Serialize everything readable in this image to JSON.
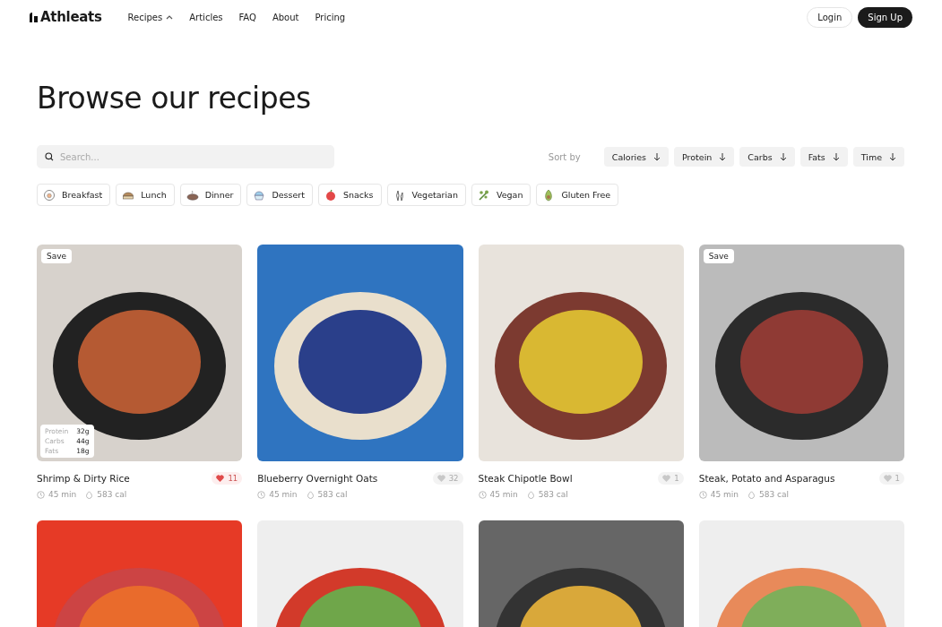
{
  "brand": "Athleats",
  "nav": [
    {
      "label": "Recipes",
      "dropdown": true
    },
    {
      "label": "Articles",
      "dropdown": false
    },
    {
      "label": "FAQ",
      "dropdown": false
    },
    {
      "label": "About",
      "dropdown": false
    },
    {
      "label": "Pricing",
      "dropdown": false
    }
  ],
  "auth": {
    "login": "Login",
    "signup": "Sign Up"
  },
  "heading": "Browse our recipes",
  "search": {
    "placeholder": "Search..."
  },
  "sort": {
    "label": "Sort by",
    "options": [
      "Calories",
      "Protein",
      "Carbs",
      "Fats",
      "Time"
    ]
  },
  "categories": [
    "Breakfast",
    "Lunch",
    "Dinner",
    "Dessert",
    "Snacks",
    "Vegetarian",
    "Vegan",
    "Gluten Free"
  ],
  "cards": [
    {
      "kind": "recipe",
      "title": "Shrimp & Dirty Rice",
      "time": "45 min",
      "calories": "583 cal",
      "likes": "11",
      "liked": true,
      "save_label": "Save",
      "macros": [
        {
          "label": "Protein",
          "value": "32g"
        },
        {
          "label": "Carbs",
          "value": "44g"
        },
        {
          "label": "Fats",
          "value": "18g"
        }
      ]
    },
    {
      "kind": "recipe",
      "title": "Blueberry Overnight Oats",
      "time": "45 min",
      "calories": "583 cal",
      "likes": "32",
      "liked": false
    },
    {
      "kind": "recipe",
      "title": "Steak Chipotle Bowl",
      "time": "45 min",
      "calories": "583 cal",
      "likes": "1",
      "liked": false
    },
    {
      "kind": "recipe",
      "title": "Steak, Potato and Asparagus",
      "time": "45 min",
      "calories": "583 cal",
      "likes": "1",
      "liked": false,
      "save_label": "Save"
    },
    {
      "kind": "photo"
    },
    {
      "kind": "photo"
    },
    {
      "kind": "photo"
    },
    {
      "kind": "photo"
    }
  ]
}
